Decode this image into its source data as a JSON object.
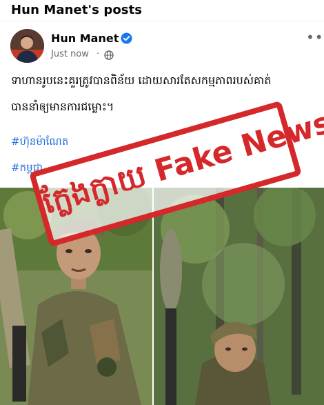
{
  "header": {
    "title": "Hun Manet's posts"
  },
  "post": {
    "author": "Hun Manet",
    "time": "Just now",
    "time_separator": "·",
    "more_label": "•••",
    "text_line1": "ទាហានរូបនេះគួរត្រូវបានពិន័យ ដោយសារតែសកម្មភាពរបស់គាត់",
    "text_line2": "បាននាំឲ្យមានការជម្លោះ។",
    "hashtag1": "#ហ៊ុនម៉ាណែត",
    "hashtag2": "#កម្ពុជា"
  },
  "stamp": {
    "text": "ក្លែងក្លាយ Fake News"
  },
  "icons": {
    "verified": "verified-check-icon",
    "audience": "globe-icon",
    "more": "more-options-icon"
  },
  "colors": {
    "link": "#216fdb",
    "verified": "#1877f2",
    "stamp": "#d4282b",
    "secondary_text": "#65676b"
  }
}
